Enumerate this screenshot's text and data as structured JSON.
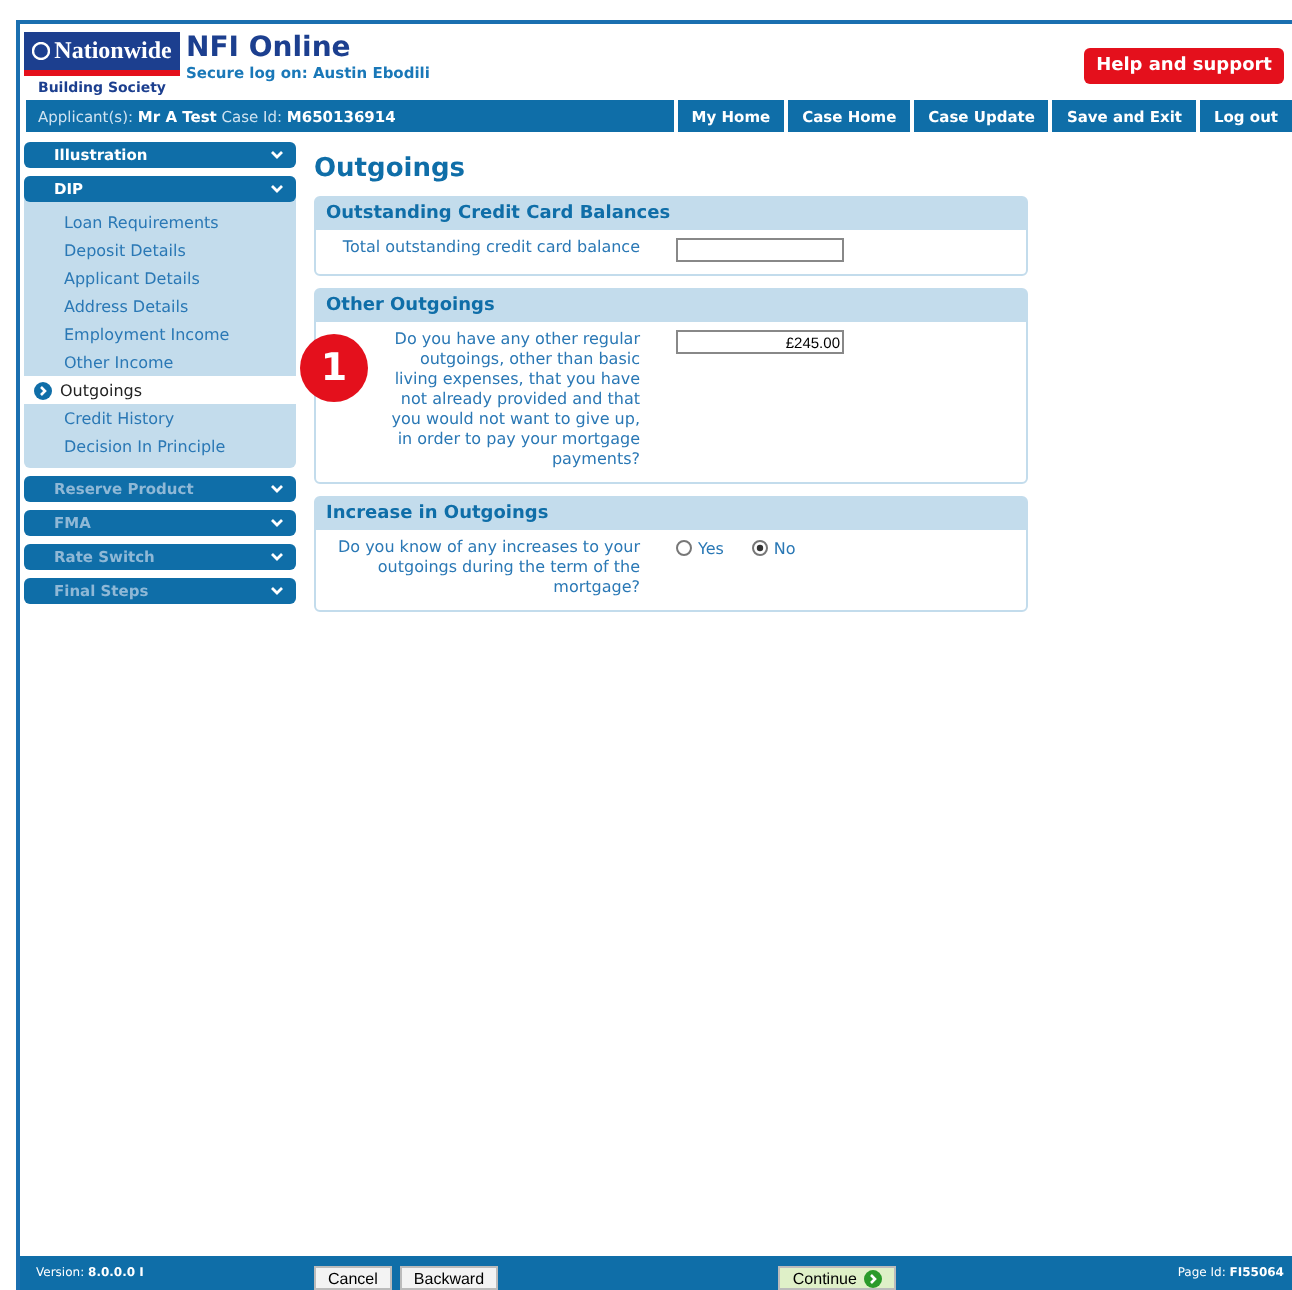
{
  "header": {
    "logo_name": "Nationwide",
    "logo_sub": "Building Society",
    "title": "NFI Online",
    "secure_log_on": "Secure log on: Austin Ebodili",
    "help_button": "Help and support"
  },
  "nav_bar": {
    "applicant_label": "Applicant(s):",
    "applicant": "Mr A Test",
    "case_label": "Case Id:",
    "case_id": "M650136914",
    "links": [
      "My Home",
      "Case Home",
      "Case Update",
      "Save and Exit",
      "Log out"
    ]
  },
  "sidebar": [
    {
      "label": "Illustration",
      "expanded": false,
      "disabled": false
    },
    {
      "label": "DIP",
      "expanded": true,
      "disabled": false,
      "items": [
        {
          "label": "Loan Requirements",
          "selected": false
        },
        {
          "label": "Deposit Details",
          "selected": false
        },
        {
          "label": "Applicant Details",
          "selected": false
        },
        {
          "label": "Address Details",
          "selected": false
        },
        {
          "label": "Employment Income",
          "selected": false
        },
        {
          "label": "Other Income",
          "selected": false
        },
        {
          "label": "Outgoings",
          "selected": true
        },
        {
          "label": "Credit History",
          "selected": false
        },
        {
          "label": "Decision In Principle",
          "selected": false
        }
      ]
    },
    {
      "label": "Reserve Product",
      "expanded": false,
      "disabled": true
    },
    {
      "label": "FMA",
      "expanded": false,
      "disabled": true
    },
    {
      "label": "Rate Switch",
      "expanded": false,
      "disabled": true
    },
    {
      "label": "Final Steps",
      "expanded": false,
      "disabled": true
    }
  ],
  "page_title": "Outgoings",
  "sections": [
    {
      "title": "Outstanding Credit Card Balances",
      "kind": "input",
      "question": "Total outstanding credit card balance"
    },
    {
      "title": "Other Outgoings",
      "kind": "input",
      "question": "Do you have any other regular outgoings, other than basic living expenses, that you have not already provided and that you would not want to give up, in order to pay your mortgage payments?",
      "value": "£245.00"
    },
    {
      "title": "Increase in Outgoings",
      "kind": "radio",
      "question": "Do you know of any increases to your outgoings during the term of the mortgage?",
      "options": [
        {
          "label": "Yes",
          "selected": false
        },
        {
          "label": "No",
          "selected": true
        }
      ]
    }
  ],
  "annotation_badge": "1",
  "footer": {
    "version_label": "Version:",
    "version": "8.0.0.0 I",
    "buttons": [
      "Cancel",
      "Backward"
    ],
    "continue_button": "Continue",
    "page_id_label": "Page Id:",
    "page_id": "FI55064"
  }
}
